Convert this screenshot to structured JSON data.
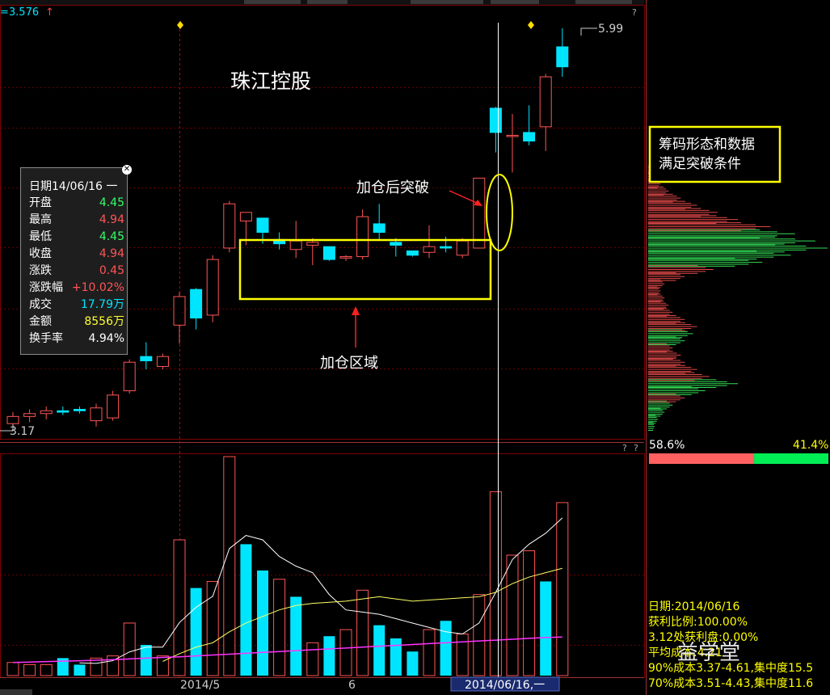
{
  "header": {
    "ma_value": "=3.576",
    "arrow": "↑"
  },
  "help_icon_label": "?",
  "annotations": {
    "stock_name": "珠江控股",
    "breakout_label": "加仓后突破",
    "zone_label": "加仓区域",
    "chip_box": [
      "筹码形态和数据",
      "满足突破条件"
    ]
  },
  "price_axis": {
    "high_label": "5.99",
    "low_label": "3.17"
  },
  "date_axis": {
    "labels": [
      "2014/5",
      "6"
    ],
    "cursor_label": "2014/06/16,一"
  },
  "tooltip": {
    "title": "日期14/06/16 一",
    "close_glyph": "✕",
    "rows": [
      {
        "label": "开盘",
        "value": "4.45",
        "color": "#33ff66"
      },
      {
        "label": "最高",
        "value": "4.94",
        "color": "#ff5555"
      },
      {
        "label": "最低",
        "value": "4.45",
        "color": "#33ff66"
      },
      {
        "label": "收盘",
        "value": "4.94",
        "color": "#ff5555"
      },
      {
        "label": "涨跌",
        "value": "0.45",
        "color": "#ff5555"
      },
      {
        "label": "涨跌幅",
        "value": "+10.02%",
        "color": "#ff5555"
      },
      {
        "label": "成交",
        "value": "17.79万",
        "color": "#00e5ff"
      },
      {
        "label": "金额",
        "value": "8556万",
        "color": "#ffff33"
      },
      {
        "label": "换手率",
        "value": "4.94%",
        "color": "#ffffff"
      }
    ]
  },
  "chip_panel": {
    "profit_pct": "58.6%",
    "loss_pct": "41.4%",
    "profit_ratio": 0.586
  },
  "chip_info": [
    "日期:2014/06/16",
    "获利比例:100.00%",
    "3.12处获利盘:0.00%",
    "平均成本:4.21",
    "90%成本3.37-4.61,集中度15.5",
    "70%成本3.51-4.43,集中度11.6"
  ],
  "watermark": "益学堂",
  "colors": {
    "up": "#ff5555",
    "down": "#00e5ff",
    "yellow": "#ffff00",
    "grid": "#800000"
  },
  "chart_data": {
    "type": "candlestick",
    "price_range": [
      3.17,
      5.99
    ],
    "candles": [
      {
        "o": 3.22,
        "h": 3.3,
        "l": 3.17,
        "c": 3.27
      },
      {
        "o": 3.27,
        "h": 3.32,
        "l": 3.23,
        "c": 3.29
      },
      {
        "o": 3.29,
        "h": 3.34,
        "l": 3.25,
        "c": 3.31
      },
      {
        "o": 3.31,
        "h": 3.34,
        "l": 3.28,
        "c": 3.3
      },
      {
        "o": 3.32,
        "h": 3.34,
        "l": 3.29,
        "c": 3.31
      },
      {
        "o": 3.24,
        "h": 3.36,
        "l": 3.2,
        "c": 3.33
      },
      {
        "o": 3.26,
        "h": 3.45,
        "l": 3.24,
        "c": 3.42
      },
      {
        "o": 3.45,
        "h": 3.67,
        "l": 3.43,
        "c": 3.65
      },
      {
        "o": 3.69,
        "h": 3.79,
        "l": 3.6,
        "c": 3.66
      },
      {
        "o": 3.62,
        "h": 3.71,
        "l": 3.6,
        "c": 3.69
      },
      {
        "o": 3.91,
        "h": 4.14,
        "l": 3.78,
        "c": 4.11
      },
      {
        "o": 4.16,
        "h": 4.17,
        "l": 3.88,
        "c": 3.96
      },
      {
        "o": 3.98,
        "h": 4.4,
        "l": 3.93,
        "c": 4.37
      },
      {
        "o": 4.45,
        "h": 4.78,
        "l": 4.42,
        "c": 4.76
      },
      {
        "o": 4.64,
        "h": 4.69,
        "l": 4.47,
        "c": 4.7
      },
      {
        "o": 4.66,
        "h": 4.66,
        "l": 4.48,
        "c": 4.56
      },
      {
        "o": 4.51,
        "h": 4.56,
        "l": 4.44,
        "c": 4.48
      },
      {
        "o": 4.44,
        "h": 4.64,
        "l": 4.38,
        "c": 4.5
      },
      {
        "o": 4.47,
        "h": 4.52,
        "l": 4.33,
        "c": 4.49
      },
      {
        "o": 4.46,
        "h": 4.46,
        "l": 4.36,
        "c": 4.37
      },
      {
        "o": 4.38,
        "h": 4.4,
        "l": 4.36,
        "c": 4.39
      },
      {
        "o": 4.39,
        "h": 4.72,
        "l": 4.37,
        "c": 4.67
      },
      {
        "o": 4.62,
        "h": 4.76,
        "l": 4.5,
        "c": 4.56
      },
      {
        "o": 4.49,
        "h": 4.52,
        "l": 4.39,
        "c": 4.47
      },
      {
        "o": 4.43,
        "h": 4.43,
        "l": 4.39,
        "c": 4.4
      },
      {
        "o": 4.42,
        "h": 4.61,
        "l": 4.38,
        "c": 4.46
      },
      {
        "o": 4.46,
        "h": 4.53,
        "l": 4.42,
        "c": 4.45
      },
      {
        "o": 4.4,
        "h": 4.52,
        "l": 4.38,
        "c": 4.5
      },
      {
        "o": 4.45,
        "h": 4.94,
        "l": 4.45,
        "c": 4.94
      },
      {
        "o": 5.43,
        "h": 5.44,
        "l": 5.12,
        "c": 5.26
      },
      {
        "o": 5.24,
        "h": 5.39,
        "l": 4.98,
        "c": 5.24
      },
      {
        "o": 5.26,
        "h": 5.45,
        "l": 5.17,
        "c": 5.2
      },
      {
        "o": 5.3,
        "h": 5.67,
        "l": 5.13,
        "c": 5.65
      },
      {
        "o": 5.86,
        "h": 5.99,
        "l": 5.65,
        "c": 5.72
      }
    ],
    "volume": {
      "ylim": [
        0,
        100
      ],
      "bars": [
        {
          "v": 6,
          "up": true
        },
        {
          "v": 5,
          "up": true
        },
        {
          "v": 5,
          "up": true
        },
        {
          "v": 8,
          "up": false
        },
        {
          "v": 5,
          "up": false
        },
        {
          "v": 8,
          "up": true
        },
        {
          "v": 9,
          "up": true
        },
        {
          "v": 24,
          "up": true
        },
        {
          "v": 14,
          "up": false
        },
        {
          "v": 9,
          "up": true
        },
        {
          "v": 62,
          "up": true
        },
        {
          "v": 40,
          "up": false
        },
        {
          "v": 43,
          "up": true
        },
        {
          "v": 100,
          "up": true
        },
        {
          "v": 60,
          "up": false
        },
        {
          "v": 48,
          "up": false
        },
        {
          "v": 44,
          "up": true
        },
        {
          "v": 36,
          "up": false
        },
        {
          "v": 15,
          "up": true
        },
        {
          "v": 18,
          "up": false
        },
        {
          "v": 21,
          "up": true
        },
        {
          "v": 39,
          "up": true
        },
        {
          "v": 23,
          "up": false
        },
        {
          "v": 17,
          "up": false
        },
        {
          "v": 11,
          "up": false
        },
        {
          "v": 21,
          "up": true
        },
        {
          "v": 25,
          "up": false
        },
        {
          "v": 19,
          "up": true
        },
        {
          "v": 37,
          "up": true
        },
        {
          "v": 84,
          "up": true
        },
        {
          "v": 55,
          "up": true
        },
        {
          "v": 57,
          "up": true
        },
        {
          "v": 43,
          "up": false
        },
        {
          "v": 79,
          "up": true
        }
      ],
      "ma_white": [
        null,
        null,
        null,
        null,
        5.8,
        5.6,
        6.8,
        10.8,
        13,
        13,
        24.2,
        31.2,
        36.2,
        58,
        64,
        62,
        54.4,
        50,
        47,
        37,
        30,
        29,
        28,
        26,
        24,
        22,
        20,
        19,
        24,
        38,
        53,
        60,
        65,
        72
      ],
      "ma_yellow": [
        null,
        null,
        null,
        null,
        null,
        null,
        null,
        null,
        null,
        6.5,
        10,
        13,
        15,
        20,
        24,
        27,
        30,
        32,
        33,
        33.5,
        34,
        35,
        36,
        35,
        34,
        34.5,
        35,
        35.5,
        36,
        38,
        42,
        45,
        47,
        49
      ],
      "ma_magenta": [
        6,
        6.2,
        6.4,
        6.6,
        6.8,
        7,
        7.3,
        7.6,
        8,
        8.3,
        8.6,
        9,
        9.4,
        9.8,
        10.2,
        10.6,
        11,
        11.4,
        11.8,
        12.2,
        12.6,
        13,
        13.4,
        13.8,
        14.2,
        14.6,
        15,
        15.4,
        15.8,
        16.2,
        16.6,
        17,
        17.4,
        17.6
      ]
    },
    "chip_distribution": {
      "price_range": [
        3.17,
        5.99
      ],
      "profile": [
        {
          "p": 3.2,
          "v": 8,
          "s": "g"
        },
        {
          "p": 3.25,
          "v": 12,
          "s": "g"
        },
        {
          "p": 3.3,
          "v": 20,
          "s": "g"
        },
        {
          "p": 3.35,
          "v": 30,
          "s": "g"
        },
        {
          "p": 3.4,
          "v": 45,
          "s": "r"
        },
        {
          "p": 3.45,
          "v": 70,
          "s": "g"
        },
        {
          "p": 3.5,
          "v": 110,
          "s": "g"
        },
        {
          "p": 3.55,
          "v": 75,
          "s": "r"
        },
        {
          "p": 3.6,
          "v": 60,
          "s": "r"
        },
        {
          "p": 3.65,
          "v": 45,
          "s": "r"
        },
        {
          "p": 3.7,
          "v": 40,
          "s": "r"
        },
        {
          "p": 3.75,
          "v": 30,
          "s": "r"
        },
        {
          "p": 3.8,
          "v": 45,
          "s": "g"
        },
        {
          "p": 3.85,
          "v": 55,
          "s": "g"
        },
        {
          "p": 3.9,
          "v": 60,
          "s": "r"
        },
        {
          "p": 3.95,
          "v": 45,
          "s": "r"
        },
        {
          "p": 4.0,
          "v": 30,
          "s": "r"
        },
        {
          "p": 4.05,
          "v": 25,
          "s": "r"
        },
        {
          "p": 4.1,
          "v": 20,
          "s": "r"
        },
        {
          "p": 4.15,
          "v": 15,
          "s": "r"
        },
        {
          "p": 4.2,
          "v": 20,
          "s": "r"
        },
        {
          "p": 4.25,
          "v": 45,
          "s": "r"
        },
        {
          "p": 4.3,
          "v": 80,
          "s": "r"
        },
        {
          "p": 4.35,
          "v": 140,
          "s": "g"
        },
        {
          "p": 4.4,
          "v": 175,
          "s": "g"
        },
        {
          "p": 4.45,
          "v": 220,
          "s": "g"
        },
        {
          "p": 4.5,
          "v": 205,
          "s": "g"
        },
        {
          "p": 4.55,
          "v": 180,
          "s": "g"
        },
        {
          "p": 4.6,
          "v": 150,
          "s": "r"
        },
        {
          "p": 4.65,
          "v": 110,
          "s": "r"
        },
        {
          "p": 4.7,
          "v": 85,
          "s": "r"
        },
        {
          "p": 4.75,
          "v": 60,
          "s": "r"
        },
        {
          "p": 4.8,
          "v": 40,
          "s": "r"
        },
        {
          "p": 4.85,
          "v": 25,
          "s": "r"
        },
        {
          "p": 4.9,
          "v": 15,
          "s": "r"
        },
        {
          "p": 4.95,
          "v": 10,
          "s": "r"
        },
        {
          "p": 5.0,
          "v": 6,
          "s": "r"
        }
      ]
    }
  }
}
